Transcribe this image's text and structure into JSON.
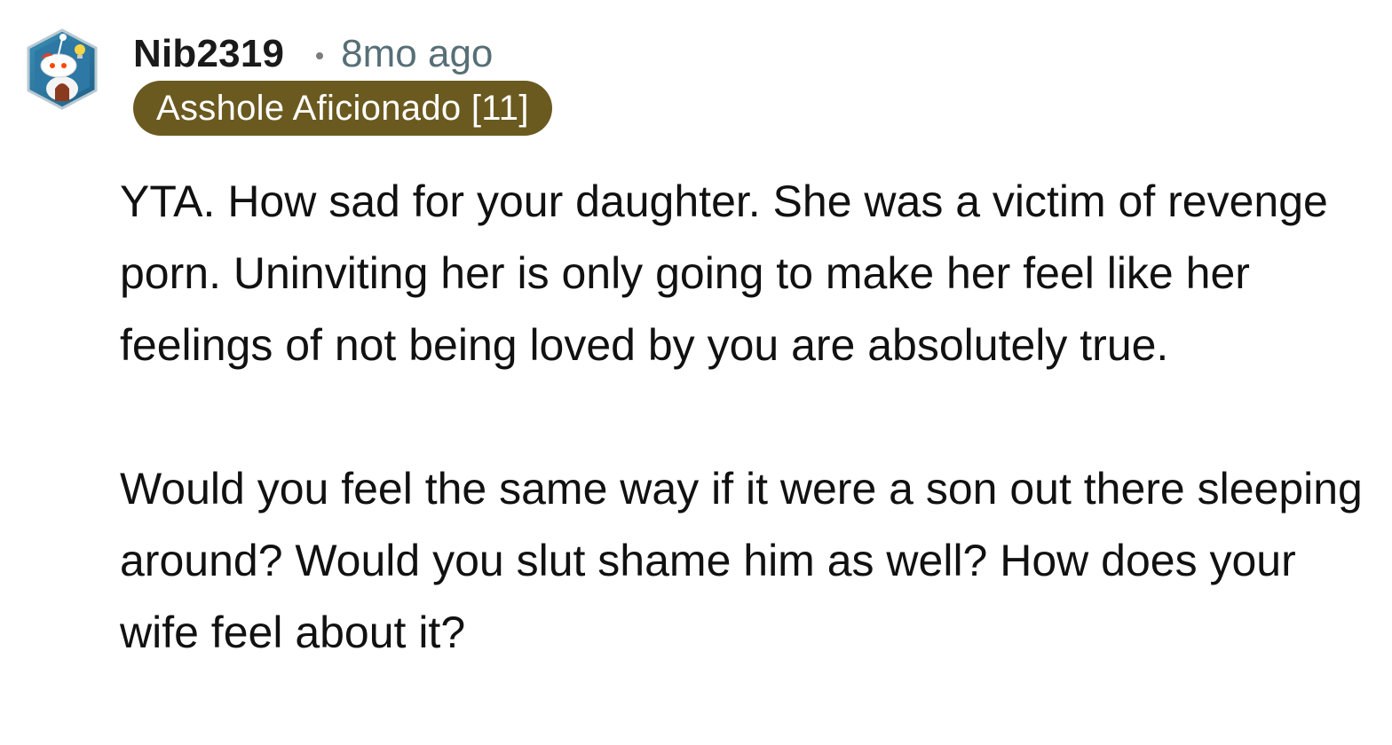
{
  "comment": {
    "author": {
      "username": "Nib2319",
      "avatar_icon": "snoo-avatar-icon"
    },
    "timestamp": "8mo ago",
    "flair": {
      "text": "Asshole Aficionado [11]",
      "background_color": "#6b5a20",
      "text_color": "#ffffff"
    },
    "paragraphs": [
      "YTA. How sad for your daughter. She was a victim of revenge porn. Uninviting her is only going to make her feel like her feelings of not being loved by you are absolutely true.",
      "Would you feel the same way if it were a son out there sleeping around? Would you slut shame him as well? How does your wife feel about it?"
    ]
  }
}
